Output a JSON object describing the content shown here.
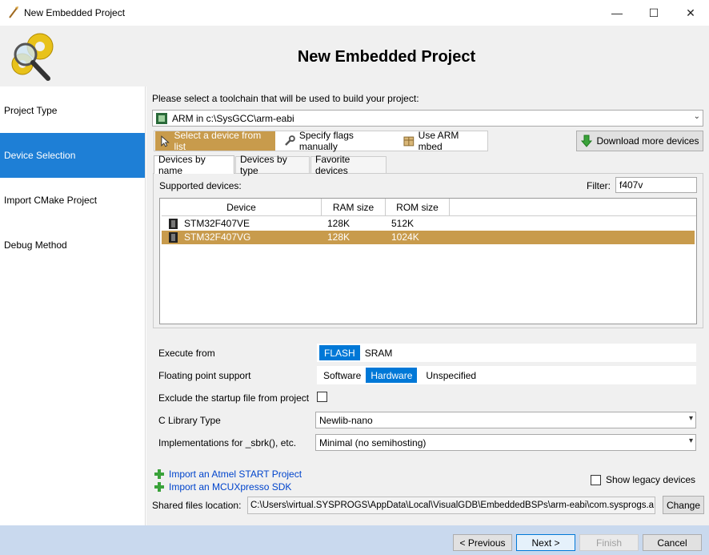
{
  "window": {
    "title": "New Embedded Project",
    "heading": "New Embedded Project",
    "controls": {
      "minimize": "—",
      "maximize": "☐",
      "close": "✕"
    }
  },
  "sidebar": {
    "items": [
      {
        "label": "Project Type",
        "active": false
      },
      {
        "label": "Device Selection",
        "active": true
      },
      {
        "label": "Import CMake Project",
        "active": false
      },
      {
        "label": "Debug Method",
        "active": false
      }
    ]
  },
  "toolchain": {
    "prompt": "Please select a toolchain that will be used to build your project:",
    "selected": "ARM in c:\\SysGCC\\arm-eabi"
  },
  "modes": {
    "select_from_list": "Select a device from list",
    "specify_flags": "Specify flags manually",
    "use_mbed": "Use ARM mbed",
    "download_more": "Download more devices"
  },
  "tabs": {
    "by_name": "Devices by name",
    "by_type": "Devices by type",
    "favorites": "Favorite devices"
  },
  "devices": {
    "supported_label": "Supported devices:",
    "filter_label": "Filter:",
    "filter_value": "f407v",
    "columns": {
      "device": "Device",
      "ram": "RAM size",
      "rom": "ROM size"
    },
    "rows": [
      {
        "device": "STM32F407VE",
        "ram": "128K",
        "rom": "512K",
        "selected": false
      },
      {
        "device": "STM32F407VG",
        "ram": "128K",
        "rom": "1024K",
        "selected": true
      }
    ]
  },
  "settings": {
    "execute_from": {
      "label": "Execute from",
      "options": [
        "FLASH",
        "SRAM"
      ],
      "selected": "FLASH"
    },
    "float": {
      "label": "Floating point support",
      "options": [
        "Software",
        "Hardware",
        "Unspecified"
      ],
      "selected": "Hardware"
    },
    "exclude_startup": {
      "label": "Exclude the startup file from project",
      "checked": false
    },
    "clib": {
      "label": "C Library Type",
      "value": "Newlib-nano"
    },
    "impl": {
      "label": "Implementations for _sbrk(), etc.",
      "value": "Minimal (no semihosting)"
    }
  },
  "links": {
    "atmel": "Import an Atmel START Project",
    "mcux": "Import an MCUXpresso SDK"
  },
  "legacy": {
    "label": "Show legacy devices",
    "checked": false
  },
  "shared": {
    "label": "Shared files location:",
    "path": "C:\\Users\\virtual.SYSPROGS\\AppData\\Local\\VisualGDB\\EmbeddedBSPs\\arm-eabi\\com.sysprogs.a",
    "change": "Change"
  },
  "nav": {
    "previous": "< Previous",
    "next": "Next >",
    "finish": "Finish",
    "cancel": "Cancel"
  }
}
